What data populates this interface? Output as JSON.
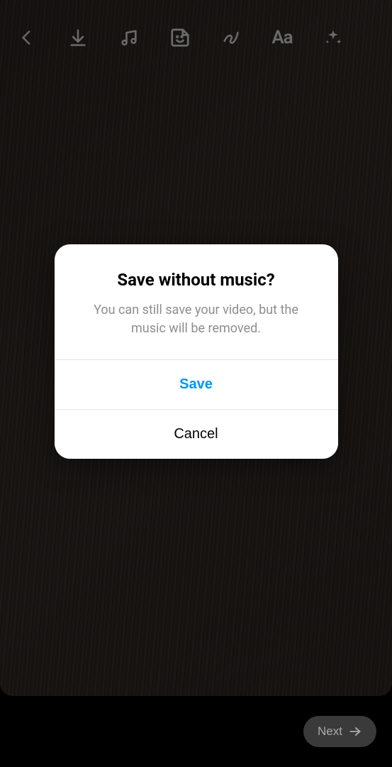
{
  "toolbar": {
    "back_name": "back-icon",
    "download_name": "download-icon",
    "music_name": "music-icon",
    "sticker_name": "sticker-icon",
    "draw_name": "draw-icon",
    "text_label": "Aa",
    "effects_name": "sparkle-icon"
  },
  "modal": {
    "title": "Save without music?",
    "message": "You can still save your video, but the music will be removed.",
    "primary_label": "Save",
    "secondary_label": "Cancel"
  },
  "bottom": {
    "next_label": "Next"
  },
  "colors": {
    "accent_blue": "#0095f6"
  }
}
